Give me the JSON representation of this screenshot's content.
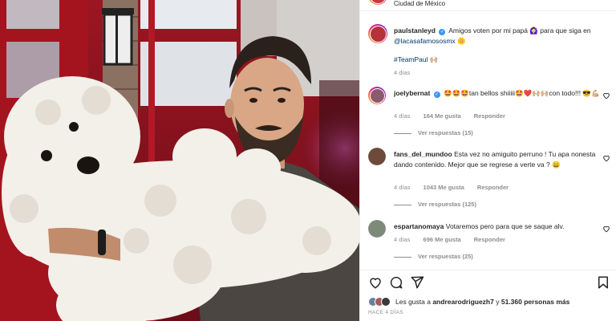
{
  "post": {
    "location": "Ciudad de México",
    "author": "paulstanleyd",
    "caption_text": "Amigos voten por mi papá 🙆🏻‍♀️ para que siga en",
    "caption_mention": "@lacasafamososmx",
    "caption_emoji": "🌼",
    "hashtag": "#TeamPaul",
    "hashtag_emoji": "🙌🏼",
    "time": "4 días"
  },
  "comments": [
    {
      "username": "joelybernat",
      "verified": true,
      "text": "🤩🤩🤩tan bellos shiiiii🤩❤️🙌🏼🙌🏼con todo!!! 😎💪🏼",
      "time": "4 días",
      "likes": "164 Me gusta",
      "reply_label": "Responder",
      "replies": "Ver respuestas (15)"
    },
    {
      "username": "fans_del_mundoo",
      "verified": false,
      "text": "Esta vez no amiguito perruno ! Tu apa nonesta dando contenido. Mejor que se regrese a verte va ? 😄",
      "time": "4 días",
      "likes": "1043 Me gusta",
      "reply_label": "Responder",
      "replies": "Ver respuestas (125)"
    },
    {
      "username": "espartanomaya",
      "verified": false,
      "text": "Votaremos pero para que se saque alv.",
      "time": "4 días",
      "likes": "696 Me gusta",
      "reply_label": "Responder",
      "replies": "Ver respuestas (25)"
    }
  ],
  "footer": {
    "likes_prefix": "Les gusta a",
    "likes_user": "andrearodriguezh7",
    "likes_middle": "y",
    "likes_count": "51.360 personas más",
    "ago": "HACE 4 DÍAS"
  },
  "icons": {
    "like": "heart-icon",
    "comment": "comment-icon",
    "share": "share-icon",
    "save": "bookmark-icon",
    "verified": "verified-badge-icon"
  },
  "colors": {
    "link": "#00376b",
    "muted": "#8e8e8e",
    "verified": "#3897f0"
  }
}
